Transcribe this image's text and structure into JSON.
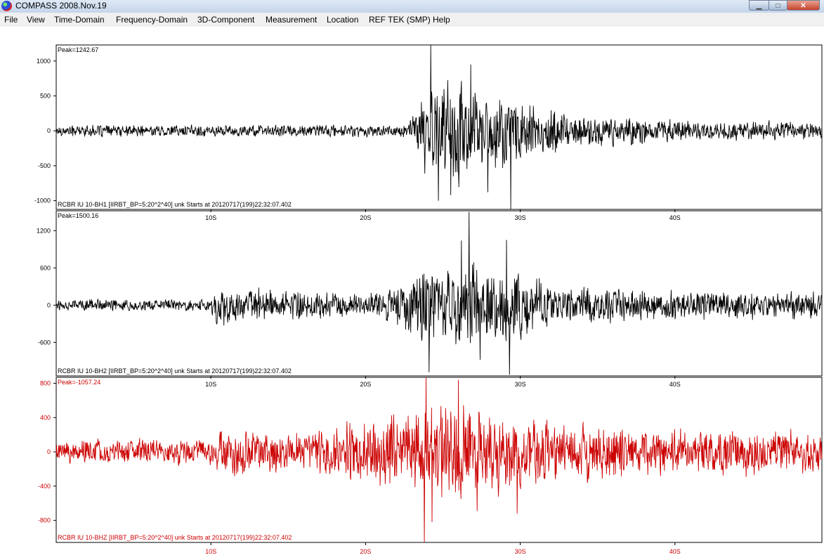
{
  "window": {
    "title": "COMPASS 2008.Nov.19",
    "minimize_glyph": "▁",
    "maximize_glyph": "□",
    "close_glyph": "✕"
  },
  "menu": {
    "items": [
      "File",
      "View",
      "Time-Domain",
      "Frequency-Domain",
      "3D-Component",
      "Measurement",
      "Location",
      "REF TEK (SMP)",
      "Help"
    ]
  },
  "colors": {
    "trace_black": "#000000",
    "trace_red": "#cc0000",
    "menu_bg": "#f0f0f0"
  },
  "chart_data": [
    {
      "type": "line",
      "peak_label": "Peak=1242.67",
      "trace_label": "RCBR IU 10-BH1  [IIRBT_BP=5:20^2^40] unk Starts at 20120717(199)22:32:07.402",
      "yticks": [
        1000,
        500,
        0,
        -500,
        -1000
      ],
      "ylim": [
        -1125,
        1230
      ],
      "xticks": [
        "10S",
        "20S",
        "30S",
        "40S"
      ],
      "xlim": [
        0,
        49.5
      ],
      "color": "#000000",
      "envelope": [
        {
          "t": 0,
          "a": 90
        },
        {
          "t": 22.5,
          "a": 100
        },
        {
          "t": 23,
          "a": 200
        },
        {
          "t": 23.8,
          "a": 650
        },
        {
          "t": 26,
          "a": 780
        },
        {
          "t": 28,
          "a": 620
        },
        {
          "t": 30,
          "a": 500
        },
        {
          "t": 33,
          "a": 280
        },
        {
          "t": 40,
          "a": 160
        },
        {
          "t": 49.5,
          "a": 130
        }
      ],
      "spikes": [
        {
          "t": 24.2,
          "v": 1242.67
        },
        {
          "t": 24.7,
          "v": -1000
        },
        {
          "t": 29.4,
          "v": -1125
        },
        {
          "t": 26.8,
          "v": 950
        },
        {
          "t": 25.5,
          "v": -920
        },
        {
          "t": 27.9,
          "v": -880
        }
      ]
    },
    {
      "type": "line",
      "peak_label": "Peak=1500.16",
      "trace_label": "RCBR IU 10-BH2  [IIRBT_BP=5:20^2^40] unk Starts at 20120717(199)22:32:07.402",
      "yticks": [
        1200,
        600,
        0,
        -600
      ],
      "ylim": [
        -1140,
        1520
      ],
      "xticks": [
        "10S",
        "20S",
        "30S",
        "40S"
      ],
      "xlim": [
        0,
        49.5
      ],
      "color": "#000000",
      "envelope": [
        {
          "t": 0,
          "a": 100
        },
        {
          "t": 10,
          "a": 110
        },
        {
          "t": 10.3,
          "a": 400
        },
        {
          "t": 12,
          "a": 300
        },
        {
          "t": 20,
          "a": 230
        },
        {
          "t": 22,
          "a": 350
        },
        {
          "t": 23.5,
          "a": 650
        },
        {
          "t": 27,
          "a": 750
        },
        {
          "t": 30,
          "a": 550
        },
        {
          "t": 33,
          "a": 350
        },
        {
          "t": 40,
          "a": 250
        },
        {
          "t": 49.5,
          "a": 240
        }
      ],
      "spikes": [
        {
          "t": 26.7,
          "v": 1500.16
        },
        {
          "t": 29.1,
          "v": 1050
        },
        {
          "t": 26.2,
          "v": 1040
        },
        {
          "t": 24.1,
          "v": -1080
        },
        {
          "t": 29.3,
          "v": -1120
        },
        {
          "t": 27.4,
          "v": -880
        }
      ]
    },
    {
      "type": "line",
      "peak_label": "Peak=-1057.24",
      "trace_label": "RCBR IU 10-BHZ  [IIRBT_BP=5:20^2^40] unk Starts at 20120717(199)22:32:07.402",
      "yticks": [
        800,
        400,
        0,
        -400,
        -800
      ],
      "ylim": [
        -1057.24,
        870
      ],
      "xticks": [
        "10S",
        "20S",
        "30S",
        "40S"
      ],
      "xlim": [
        0,
        49.5
      ],
      "color": "#cc0000",
      "envelope": [
        {
          "t": 0,
          "a": 150
        },
        {
          "t": 10,
          "a": 160
        },
        {
          "t": 10.3,
          "a": 300
        },
        {
          "t": 17,
          "a": 280
        },
        {
          "t": 19,
          "a": 380
        },
        {
          "t": 23,
          "a": 520
        },
        {
          "t": 25,
          "a": 620
        },
        {
          "t": 28,
          "a": 560
        },
        {
          "t": 32,
          "a": 380
        },
        {
          "t": 40,
          "a": 300
        },
        {
          "t": 49.5,
          "a": 260
        }
      ],
      "spikes": [
        {
          "t": 23.8,
          "v": -1057.24
        },
        {
          "t": 23.9,
          "v": 870
        },
        {
          "t": 26.0,
          "v": 840
        },
        {
          "t": 24.3,
          "v": -820
        },
        {
          "t": 29.8,
          "v": -720
        },
        {
          "t": 27.2,
          "v": -690
        }
      ]
    }
  ]
}
